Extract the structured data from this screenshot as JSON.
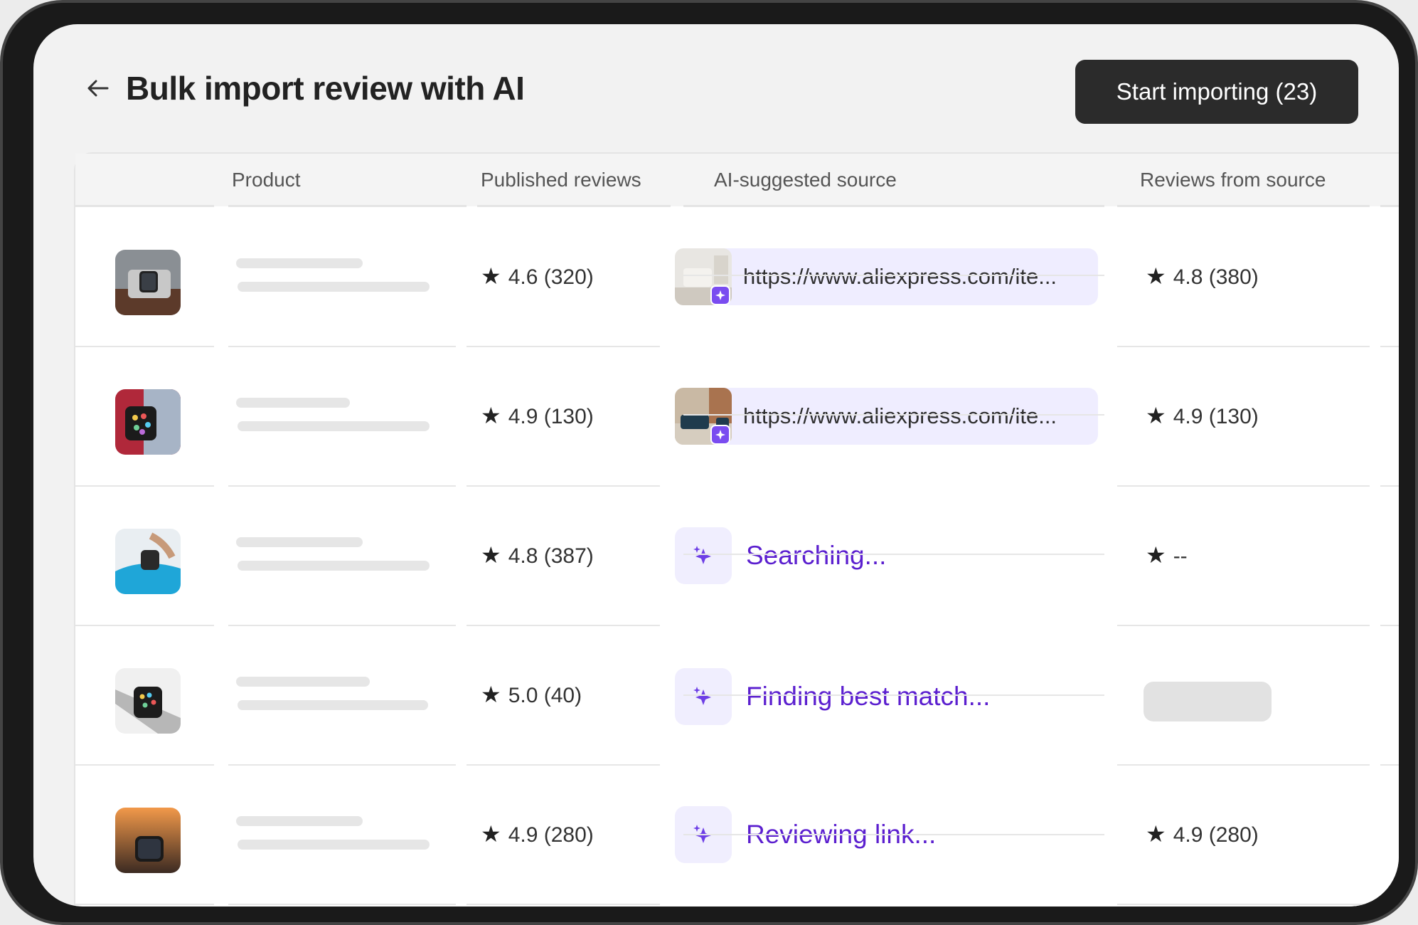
{
  "header": {
    "title": "Bulk import review with AI",
    "start_button": "Start importing (23)"
  },
  "table": {
    "columns": [
      "Product",
      "Published reviews",
      "AI-suggested source",
      "Reviews from source"
    ],
    "rows": [
      {
        "published": "4.6 (320)",
        "source_type": "link",
        "source_text": "https://www.aliexpress.com/ite...",
        "source_reviews": "4.8 (380)"
      },
      {
        "published": "4.9 (130)",
        "source_type": "link",
        "source_text": "https://www.aliexpress.com/ite...",
        "source_reviews": "4.9 (130)"
      },
      {
        "published": "4.8 (387)",
        "source_type": "status",
        "source_text": "Searching...",
        "source_reviews": "--"
      },
      {
        "published": "5.0 (40)",
        "source_type": "status",
        "source_text": "Finding best match...",
        "source_reviews": ""
      },
      {
        "published": "4.9 (280)",
        "source_type": "status",
        "source_text": "Reviewing link...",
        "source_reviews": "4.9 (280)"
      }
    ]
  },
  "icons": {
    "back": "arrow-left-icon",
    "rating": "star-icon",
    "ai": "sparkle-icon"
  },
  "colors": {
    "primary_button": "#2b2b2b",
    "ai_text": "#5b1fcf",
    "ai_tile": "#f0eefe",
    "link_bg": "#efedff",
    "badge": "#7a4cf0"
  }
}
